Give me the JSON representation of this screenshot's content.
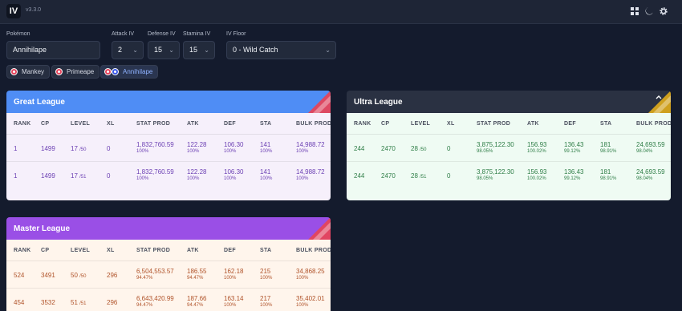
{
  "app": {
    "logo": "IV",
    "version": "v3.3.0"
  },
  "icons": [
    "grid-icon",
    "moon-icon",
    "gear-icon"
  ],
  "controls": {
    "pokemon_label": "Pokémon",
    "pokemon_value": "Annihilape",
    "attack_label": "Attack IV",
    "attack_value": "2",
    "defense_label": "Defense IV",
    "defense_value": "15",
    "stamina_label": "Stamina IV",
    "stamina_value": "15",
    "floor_label": "IV Floor",
    "floor_value": "0 - Wild Catch"
  },
  "evolutions": [
    {
      "name": "Mankey",
      "active": false
    },
    {
      "name": "Primeape",
      "active": false
    },
    {
      "name": "Annihilape",
      "active": true
    }
  ],
  "columns": [
    "RANK",
    "CP",
    "LEVEL",
    "XL",
    "STAT PROD",
    "ATK",
    "DEF",
    "STA",
    "BULK PROD"
  ],
  "leagues": {
    "great": {
      "title": "Great League",
      "colors": {
        "header": "#4f8df5",
        "body": "#f6f0fb",
        "text": "#6b3fb3",
        "corner": "#e5455a"
      },
      "rows": [
        {
          "rank": "1",
          "cp": "1499",
          "level": "17",
          "level_max": "/50",
          "xl": "0",
          "stat_prod": "1,832,760.59",
          "stat_pct": "100%",
          "atk": "122.28",
          "atk_pct": "100%",
          "def": "106.30",
          "def_pct": "100%",
          "sta": "141",
          "sta_pct": "100%",
          "bulk": "14,988.72",
          "bulk_pct": "100%"
        },
        {
          "rank": "1",
          "cp": "1499",
          "level": "17",
          "level_max": "/51",
          "xl": "0",
          "stat_prod": "1,832,760.59",
          "stat_pct": "100%",
          "atk": "122.28",
          "atk_pct": "100%",
          "def": "106.30",
          "def_pct": "100%",
          "sta": "141",
          "sta_pct": "100%",
          "bulk": "14,988.72",
          "bulk_pct": "100%"
        }
      ]
    },
    "ultra": {
      "title": "Ultra League",
      "colors": {
        "header": "#2a3142",
        "body": "#effbf3",
        "text": "#2e7d46",
        "corner": "#d8a61c"
      },
      "rows": [
        {
          "rank": "244",
          "cp": "2470",
          "level": "28",
          "level_max": "/50",
          "xl": "0",
          "stat_prod": "3,875,122.30",
          "stat_pct": "98.05%",
          "atk": "156.93",
          "atk_pct": "100.02%",
          "def": "136.43",
          "def_pct": "99.12%",
          "sta": "181",
          "sta_pct": "98.91%",
          "bulk": "24,693.59",
          "bulk_pct": "98.04%"
        },
        {
          "rank": "244",
          "cp": "2470",
          "level": "28",
          "level_max": "/51",
          "xl": "0",
          "stat_prod": "3,875,122.30",
          "stat_pct": "98.05%",
          "atk": "156.93",
          "atk_pct": "100.02%",
          "def": "136.43",
          "def_pct": "99.12%",
          "sta": "181",
          "sta_pct": "98.91%",
          "bulk": "24,693.59",
          "bulk_pct": "98.04%"
        }
      ]
    },
    "master": {
      "title": "Master League",
      "colors": {
        "header": "#9a4fe6",
        "body": "#fff5ec",
        "text": "#b0532a",
        "corner": "#e5455a"
      },
      "rows": [
        {
          "rank": "524",
          "cp": "3491",
          "level": "50",
          "level_max": "/50",
          "xl": "296",
          "stat_prod": "6,504,553.57",
          "stat_pct": "94.47%",
          "atk": "186.55",
          "atk_pct": "94.47%",
          "def": "162.18",
          "def_pct": "100%",
          "sta": "215",
          "sta_pct": "100%",
          "bulk": "34,868.25",
          "bulk_pct": "100%"
        },
        {
          "rank": "454",
          "cp": "3532",
          "level": "51",
          "level_max": "/51",
          "xl": "296",
          "stat_prod": "6,643,420.99",
          "stat_pct": "94.47%",
          "atk": "187.66",
          "atk_pct": "94.47%",
          "def": "163.14",
          "def_pct": "100%",
          "sta": "217",
          "sta_pct": "100%",
          "bulk": "35,402.01",
          "bulk_pct": "100%"
        }
      ]
    }
  }
}
